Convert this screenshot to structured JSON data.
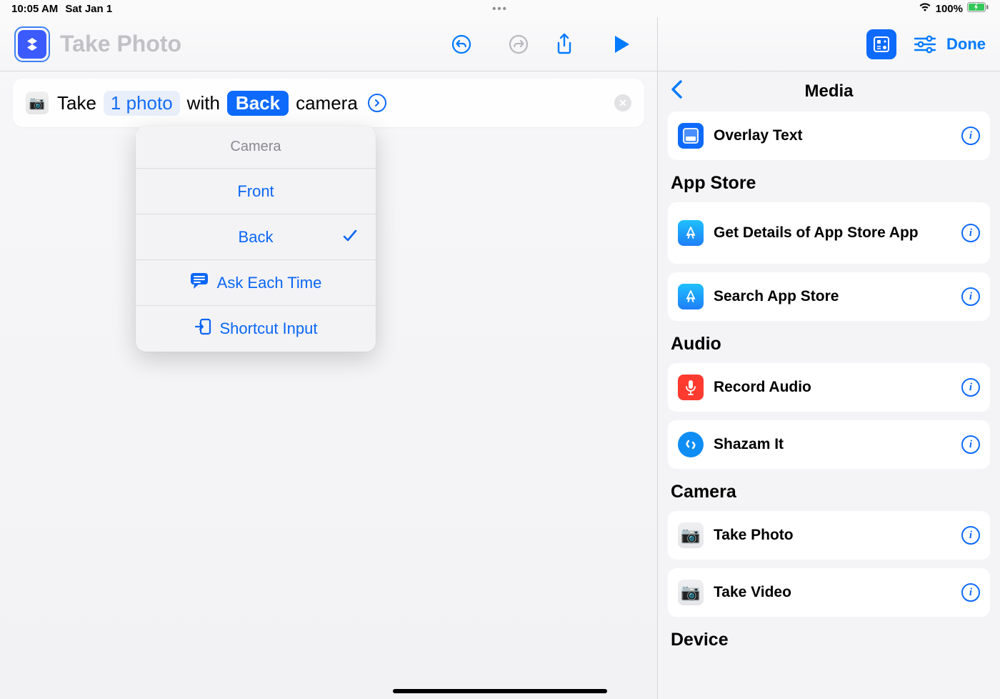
{
  "status": {
    "time": "10:05 AM",
    "date": "Sat Jan 1",
    "battery": "100%"
  },
  "toolbar": {
    "title": "Take Photo",
    "done": "Done"
  },
  "action": {
    "pre": "Take",
    "count_label": "1 photo",
    "with": "with",
    "camera_selected": "Back",
    "post": "camera"
  },
  "popover": {
    "title": "Camera",
    "front": "Front",
    "back": "Back",
    "ask": "Ask Each Time",
    "shortcut_input": "Shortcut Input"
  },
  "side": {
    "header": "Media",
    "overlay_text": "Overlay Text",
    "appstore_section": "App Store",
    "get_details": "Get Details of App Store App",
    "search_appstore": "Search App Store",
    "audio_section": "Audio",
    "record_audio": "Record Audio",
    "shazam": "Shazam It",
    "camera_section": "Camera",
    "take_photo": "Take Photo",
    "take_video": "Take Video",
    "device_section": "Device"
  }
}
